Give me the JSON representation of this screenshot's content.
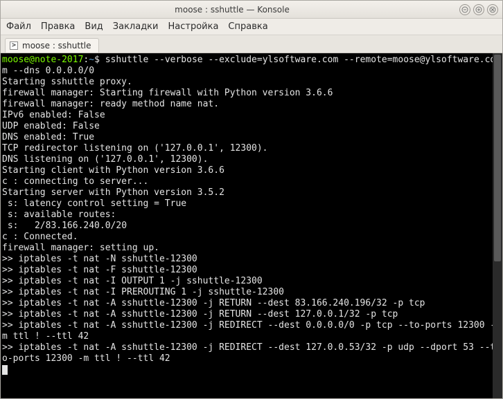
{
  "window": {
    "title": "moose : sshuttle — Konsole"
  },
  "menubar": {
    "items": [
      "Файл",
      "Правка",
      "Вид",
      "Закладки",
      "Настройка",
      "Справка"
    ]
  },
  "tab": {
    "label": "moose : sshuttle"
  },
  "prompt": {
    "user": "moose",
    "at": "@",
    "host": "note-2017",
    "colon": ":",
    "path": "~",
    "symbol": "$"
  },
  "command": "sshuttle --verbose --exclude=ylsoftware.com --remote=moose@ylsoftware.com --dns 0.0.0.0/0",
  "output_lines": [
    "Starting sshuttle proxy.",
    "firewall manager: Starting firewall with Python version 3.6.6",
    "firewall manager: ready method name nat.",
    "IPv6 enabled: False",
    "UDP enabled: False",
    "DNS enabled: True",
    "TCP redirector listening on ('127.0.0.1', 12300).",
    "DNS listening on ('127.0.0.1', 12300).",
    "Starting client with Python version 3.6.6",
    "c : connecting to server...",
    "Starting server with Python version 3.5.2",
    " s: latency control setting = True",
    " s: available routes:",
    " s:   2/83.166.240.0/20",
    "c : Connected.",
    "firewall manager: setting up.",
    ">> iptables -t nat -N sshuttle-12300",
    ">> iptables -t nat -F sshuttle-12300",
    ">> iptables -t nat -I OUTPUT 1 -j sshuttle-12300",
    ">> iptables -t nat -I PREROUTING 1 -j sshuttle-12300",
    ">> iptables -t nat -A sshuttle-12300 -j RETURN --dest 83.166.240.196/32 -p tcp",
    ">> iptables -t nat -A sshuttle-12300 -j RETURN --dest 127.0.0.1/32 -p tcp",
    ">> iptables -t nat -A sshuttle-12300 -j REDIRECT --dest 0.0.0.0/0 -p tcp --to-ports 12300 -m ttl ! --ttl 42",
    ">> iptables -t nat -A sshuttle-12300 -j REDIRECT --dest 127.0.0.53/32 -p udp --dport 53 --to-ports 12300 -m ttl ! --ttl 42"
  ],
  "window_buttons": {
    "minimize": "–",
    "maximize": "+",
    "close": "×"
  }
}
